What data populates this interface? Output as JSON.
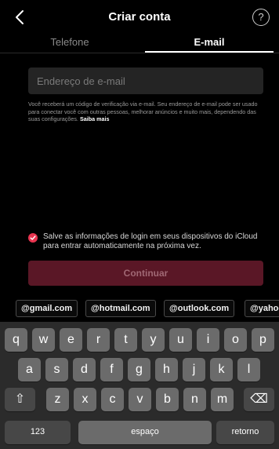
{
  "header": {
    "title": "Criar conta",
    "back_icon": "chevron-left-icon",
    "help_glyph": "?"
  },
  "tabs": [
    {
      "label": "Telefone",
      "selected": false
    },
    {
      "label": "E-mail",
      "selected": true
    }
  ],
  "form": {
    "email_placeholder": "Endereço de e-mail",
    "email_value": "",
    "info_text": "Você receberá um código de verificação via e-mail. Seu endereço de e-mail pode ser usado para conectar você com outras pessoas, melhorar anúncios e muito mais, dependendo das suas configurações.",
    "learn_more": "Saiba mais",
    "save_login_label": "Salve as informações de login em seus dispositivos do iCloud para entrar automaticamente na próxima vez.",
    "save_login_checked": true,
    "continue_label": "Continuar"
  },
  "suggestions": [
    "@gmail.com",
    "@hotmail.com",
    "@outlook.com",
    "@yahoo"
  ],
  "keyboard": {
    "row1": [
      "q",
      "w",
      "e",
      "r",
      "t",
      "y",
      "u",
      "i",
      "o",
      "p"
    ],
    "row2": [
      "a",
      "s",
      "d",
      "f",
      "g",
      "h",
      "j",
      "k",
      "l"
    ],
    "row3": [
      "z",
      "x",
      "c",
      "v",
      "b",
      "n",
      "m"
    ],
    "shift_glyph": "⇧",
    "backspace_glyph": "⌫",
    "numbers_label": "123",
    "space_label": "espaço",
    "return_label": "retorno"
  },
  "colors": {
    "accent": "#e8344f",
    "button_disabled": "#5a1726",
    "background": "#000000",
    "keyboard_bg": "#2b2b2b"
  }
}
